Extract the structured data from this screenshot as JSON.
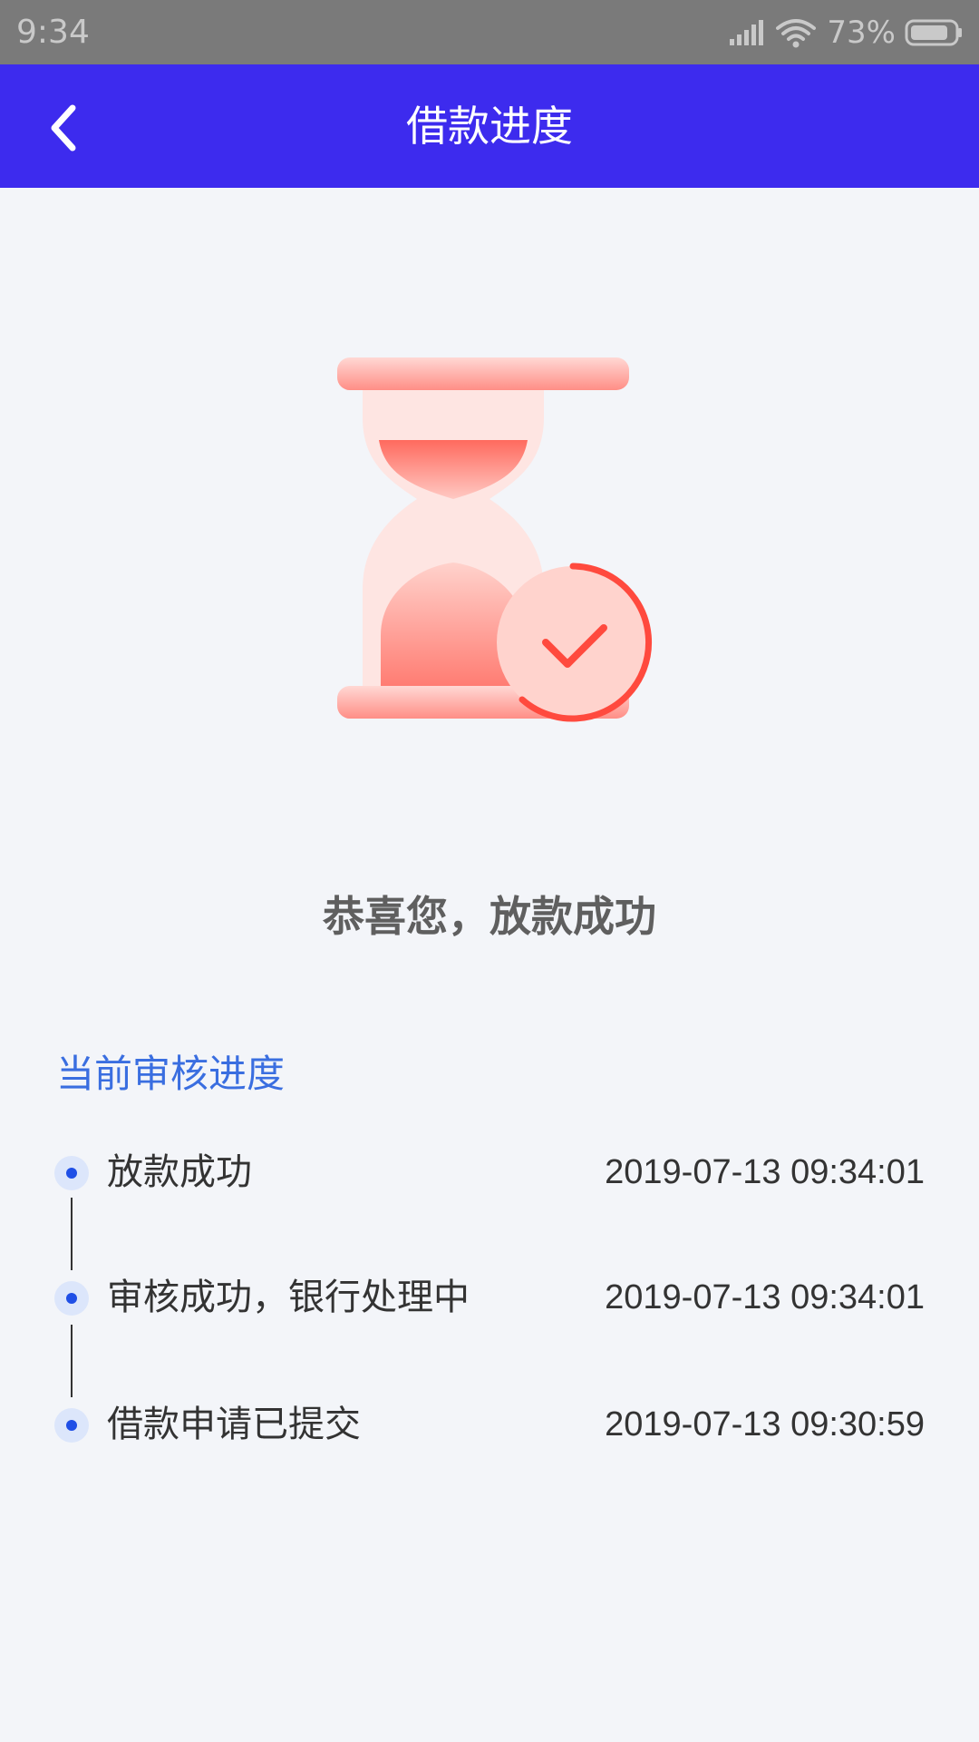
{
  "status_bar": {
    "time": "9:34",
    "battery": "73%",
    "icons": [
      "signal-icon",
      "wifi-icon",
      "battery-icon"
    ]
  },
  "nav": {
    "back_icon": "chevron-left-icon",
    "title": "借款进度"
  },
  "hero": {
    "icon": "hourglass-check-icon"
  },
  "result": {
    "message": "恭喜您，放款成功"
  },
  "progress": {
    "title": "当前审核进度",
    "steps": [
      {
        "label": "放款成功",
        "time": "2019-07-13 09:34:01"
      },
      {
        "label": "审核成功，银行处理中",
        "time": "2019-07-13 09:34:01"
      },
      {
        "label": "借款申请已提交",
        "time": "2019-07-13 09:30:59"
      }
    ]
  },
  "colors": {
    "nav_bg": "#3d2bee",
    "status_bg": "#7a7a7a",
    "page_bg": "#f3f5f9",
    "accent_text": "#3a6ee0",
    "timeline_dot": "#1f4fe6",
    "hourglass": "#ff7b73"
  }
}
